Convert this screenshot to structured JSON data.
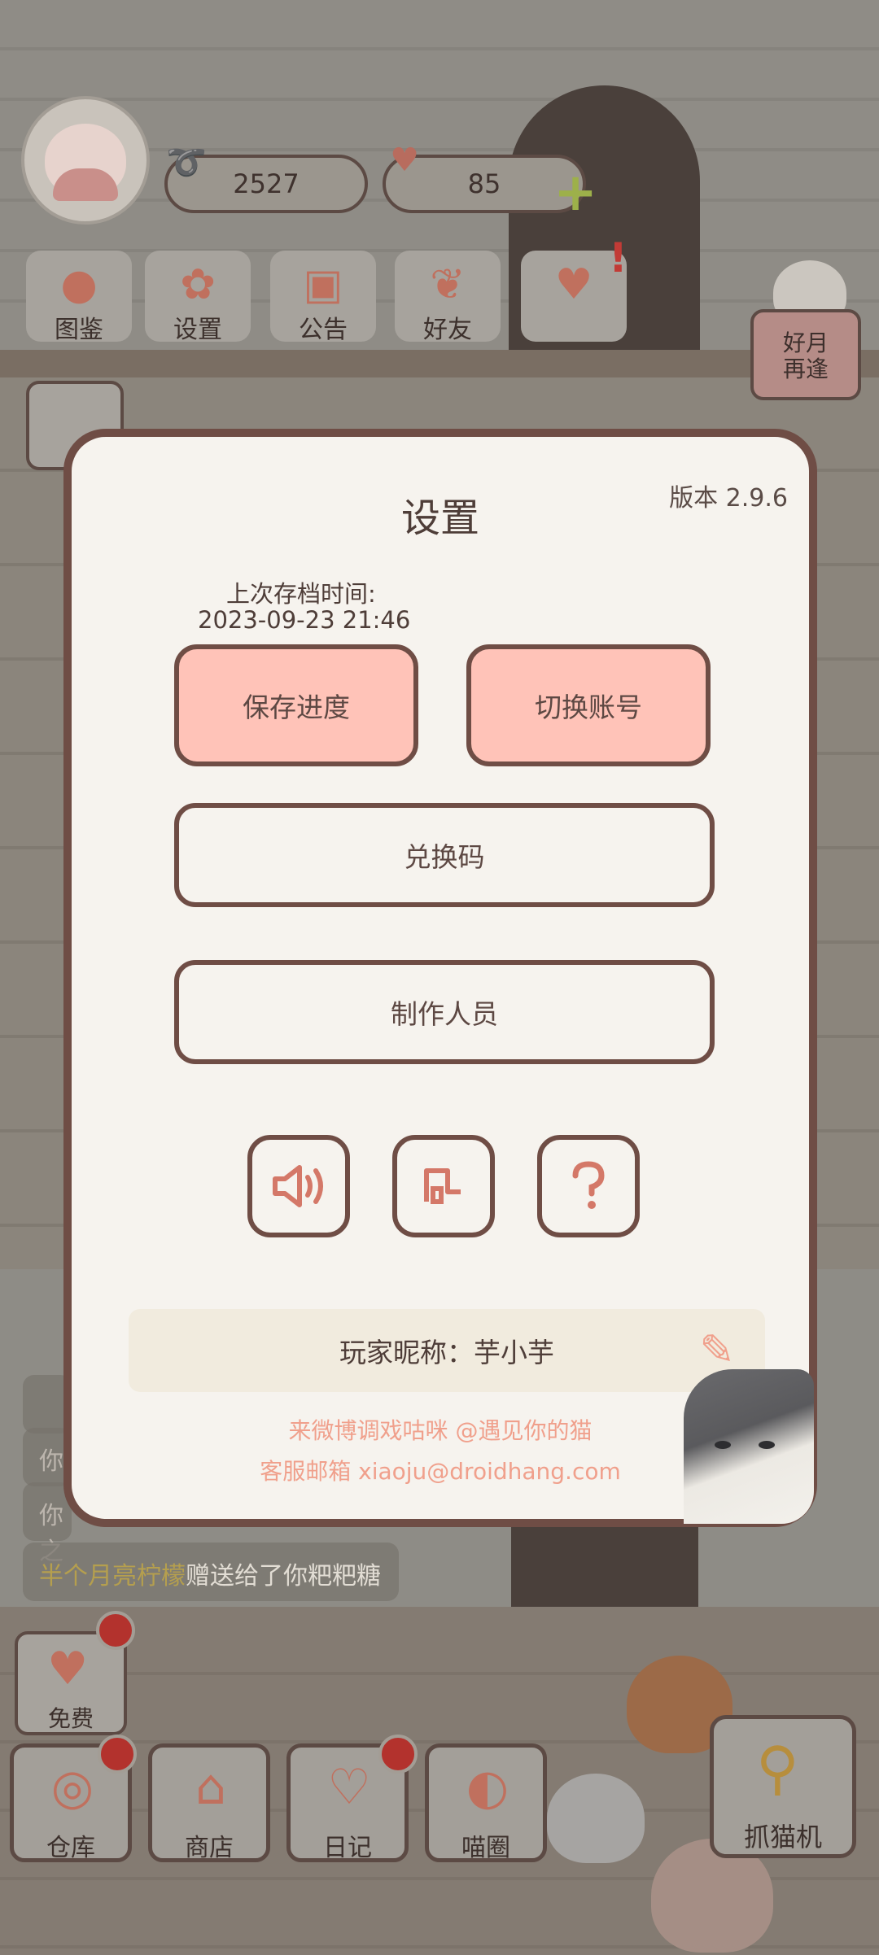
{
  "hud": {
    "fish_count": "2527",
    "heart_count": "85",
    "icons": [
      "fish-icon",
      "heart-icon",
      "plus-icon"
    ]
  },
  "top_menu": [
    {
      "label": "图鉴",
      "icon": "cat-head-icon"
    },
    {
      "label": "设置",
      "icon": "gear-icon"
    },
    {
      "label": "公告",
      "icon": "gift-icon"
    },
    {
      "label": "好友",
      "icon": "friends-icon"
    },
    {
      "label": "",
      "icon": "hearts-icon"
    }
  ],
  "event_button": {
    "line1": "好月",
    "line2": "再逢"
  },
  "chat": {
    "line1": "你",
    "line2": "你之",
    "gift_sender": "半个月亮柠檬",
    "gift_text": "赠送给了你粑粑糖"
  },
  "free_button": {
    "label": "免费"
  },
  "bottom_nav": [
    {
      "label": "仓库",
      "icon": "storage-icon"
    },
    {
      "label": "商店",
      "icon": "shop-icon"
    },
    {
      "label": "日记",
      "icon": "diary-icon"
    },
    {
      "label": "喵圈",
      "icon": "cat-planet-icon"
    }
  ],
  "claw_button": {
    "label": "抓猫机"
  },
  "settings": {
    "title": "设置",
    "version": "版本 2.9.6",
    "last_save_label": "上次存档时间:",
    "last_save_time": "2023-09-23 21:46",
    "save_button": "保存进度",
    "switch_button": "切换账号",
    "redeem_button": "兑换码",
    "credits_button": "制作人员",
    "icon_buttons": [
      "sound-icon",
      "music-icon",
      "help-icon"
    ],
    "nickname": "玩家昵称：芋小芋",
    "weibo": "来微博调戏咕咪 @遇见你的猫",
    "email": "客服邮箱 xiaoju@droidhang.com"
  },
  "colors": {
    "dialog_bg": "#f6f3ee",
    "border": "#6f4d45",
    "primary_button": "#ffc3b8",
    "accent_text": "#f0a08c",
    "nickname_bg": "#f1ebde"
  }
}
